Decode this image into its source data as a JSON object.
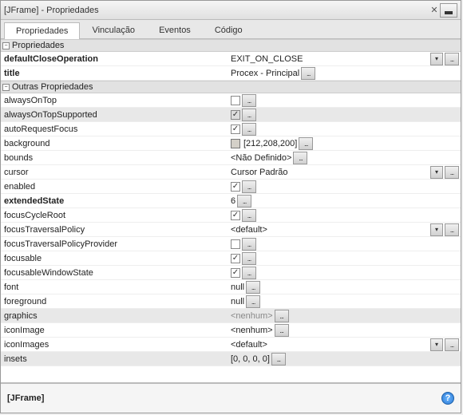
{
  "title": "[JFrame] - Propriedades",
  "tabs": [
    "Propriedades",
    "Vinculação",
    "Eventos",
    "Código"
  ],
  "active_tab": 0,
  "groups": [
    {
      "title": "Propriedades",
      "expanded": true
    },
    {
      "title": "Outras Propriedades",
      "expanded": true
    }
  ],
  "props_main": [
    {
      "name": "defaultCloseOperation",
      "bold": true,
      "type": "select",
      "value": "EXIT_ON_CLOSE"
    },
    {
      "name": "title",
      "bold": true,
      "type": "text",
      "value": "Procex - Principal"
    }
  ],
  "props_other": [
    {
      "name": "alwaysOnTop",
      "type": "check",
      "checked": false
    },
    {
      "name": "alwaysOnTopSupported",
      "type": "check",
      "checked": true,
      "disabled": true
    },
    {
      "name": "autoRequestFocus",
      "type": "check",
      "checked": true
    },
    {
      "name": "background",
      "type": "color",
      "value": "[212,208,200]",
      "swatch": "#d4d0c8"
    },
    {
      "name": "bounds",
      "type": "text",
      "value": "<Não Definido>"
    },
    {
      "name": "cursor",
      "type": "select",
      "value": "Cursor Padrão"
    },
    {
      "name": "enabled",
      "type": "check",
      "checked": true
    },
    {
      "name": "extendedState",
      "bold": true,
      "type": "text",
      "value": "6"
    },
    {
      "name": "focusCycleRoot",
      "type": "check",
      "checked": true
    },
    {
      "name": "focusTraversalPolicy",
      "type": "select",
      "value": "<default>"
    },
    {
      "name": "focusTraversalPolicyProvider",
      "type": "check",
      "checked": false
    },
    {
      "name": "focusable",
      "type": "check",
      "checked": true
    },
    {
      "name": "focusableWindowState",
      "type": "check",
      "checked": true
    },
    {
      "name": "font",
      "type": "text",
      "value": "null"
    },
    {
      "name": "foreground",
      "type": "text",
      "value": "null"
    },
    {
      "name": "graphics",
      "type": "text",
      "value": "<nenhum>",
      "disabled": true,
      "gray": true
    },
    {
      "name": "iconImage",
      "type": "text",
      "value": "<nenhum>"
    },
    {
      "name": "iconImages",
      "type": "select",
      "value": "<default>"
    },
    {
      "name": "insets",
      "type": "text",
      "value": "[0, 0, 0, 0]",
      "disabled": true
    }
  ],
  "footer": "[JFrame]",
  "help_char": "?",
  "ellipsis": "...",
  "arrow": "▾",
  "minus": "−"
}
